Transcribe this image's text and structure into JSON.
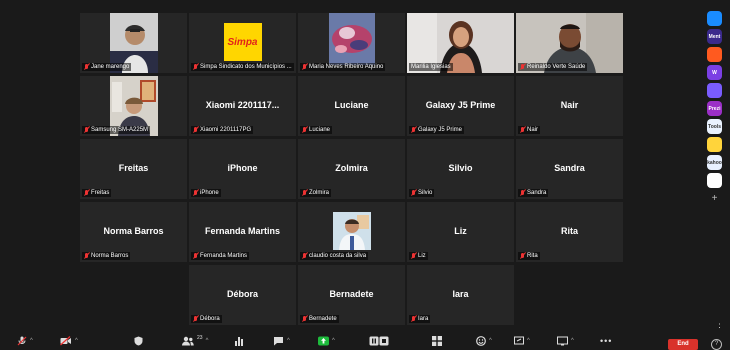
{
  "participants": [
    {
      "display_name": "",
      "label": "Jane marengo",
      "active": false,
      "video": "person-gray"
    },
    {
      "display_name": "",
      "label": "Simpa Sindicato dos Municípios ...",
      "active": false,
      "video": "simpa-logo",
      "logo_text": "Simpa"
    },
    {
      "display_name": "",
      "label": "Maria Neves Ribeiro Aquino",
      "active": false,
      "video": "painting"
    },
    {
      "display_name": "",
      "label": "Marilia Iglesias",
      "active": true,
      "video": "woman-camera"
    },
    {
      "display_name": "",
      "label": "Reinaldo Verte Saúde",
      "active": false,
      "video": "man-camera"
    },
    {
      "display_name": "",
      "label": "Samsung SM-A225M",
      "active": false,
      "video": "person-office"
    },
    {
      "display_name": "Xiaomi 2201117...",
      "label": "Xiaomi 2201117PG",
      "active": false,
      "video": ""
    },
    {
      "display_name": "Luciane",
      "label": "Luciane",
      "active": false,
      "video": ""
    },
    {
      "display_name": "Galaxy J5 Prime",
      "label": "Galaxy J5 Prime",
      "active": false,
      "video": ""
    },
    {
      "display_name": "Nair",
      "label": "Nair",
      "active": false,
      "video": ""
    },
    {
      "display_name": "Freitas",
      "label": "Freitas",
      "active": false,
      "video": ""
    },
    {
      "display_name": "iPhone",
      "label": "iPhone",
      "active": false,
      "video": ""
    },
    {
      "display_name": "Zolmira",
      "label": "Zolmira",
      "active": false,
      "video": ""
    },
    {
      "display_name": "Silvio",
      "label": "Silvio",
      "active": false,
      "video": ""
    },
    {
      "display_name": "Sandra",
      "label": "Sandra",
      "active": false,
      "video": ""
    },
    {
      "display_name": "Norma Barros",
      "label": "Norma Barros",
      "active": false,
      "video": ""
    },
    {
      "display_name": "Fernanda Martins",
      "label": "Fernanda Martins",
      "active": false,
      "video": ""
    },
    {
      "display_name": "",
      "label": "claudio costa da silva",
      "active": false,
      "video": "doctor-photo"
    },
    {
      "display_name": "Liz",
      "label": "Liz",
      "active": false,
      "video": ""
    },
    {
      "display_name": "Rita",
      "label": "Rita",
      "active": false,
      "video": ""
    },
    {
      "display_name": "Débora",
      "label": "Débora",
      "active": false,
      "video": ""
    },
    {
      "display_name": "Bernadete",
      "label": "Bernadete",
      "active": false,
      "video": ""
    },
    {
      "display_name": "Iara",
      "label": "Iara",
      "active": false,
      "video": ""
    }
  ],
  "toolbar": {
    "participant_count": "23",
    "end_label": "End",
    "icons": [
      "mic-muted-icon",
      "video-off-icon",
      "security-icon",
      "participants-icon",
      "polls-icon",
      "chat-icon",
      "share-screen-icon",
      "record-icon",
      "view-icon",
      "reactions-icon",
      "whiteboard-icon",
      "captions-icon",
      "more-icon",
      "help-icon"
    ]
  },
  "colors": {
    "background": "#1a1a1a",
    "tile": "#262626",
    "active_border": "#c8e04f",
    "muted": "#e33333",
    "share": "#1dbb3c",
    "end": "#d9322b"
  },
  "apps_sidebar": {
    "apps": [
      {
        "name": "app-blue",
        "icon": "app-blue-icon",
        "color": "#1a8cff",
        "text": ""
      },
      {
        "name": "app-mentimeter",
        "icon": "mentimeter-icon",
        "color": "#3b2a8c",
        "text": "Ment"
      },
      {
        "name": "app-orange",
        "icon": "orange-app-icon",
        "color": "#ff5a1f",
        "text": ""
      },
      {
        "name": "app-w",
        "icon": "w-app-icon",
        "color": "#7b3fe4",
        "text": "W"
      },
      {
        "name": "app-purple",
        "icon": "purple-app-icon",
        "color": "#7a5cff",
        "text": ""
      },
      {
        "name": "app-prezi",
        "icon": "prezi-icon",
        "color": "#9b2fc7",
        "text": "Prezi"
      },
      {
        "name": "app-tools",
        "icon": "tools-app-icon",
        "color": "#e9f2ff",
        "text": "Tools"
      },
      {
        "name": "app-yellow",
        "icon": "yellow-app-icon",
        "color": "#ffd43b",
        "text": ""
      },
      {
        "name": "app-kahoot",
        "icon": "kahoot-icon",
        "color": "#e8f0ff",
        "text": "kahoo"
      },
      {
        "name": "app-multicolor",
        "icon": "multicolor-app-icon",
        "color": "#ffffff",
        "text": ""
      }
    ]
  }
}
